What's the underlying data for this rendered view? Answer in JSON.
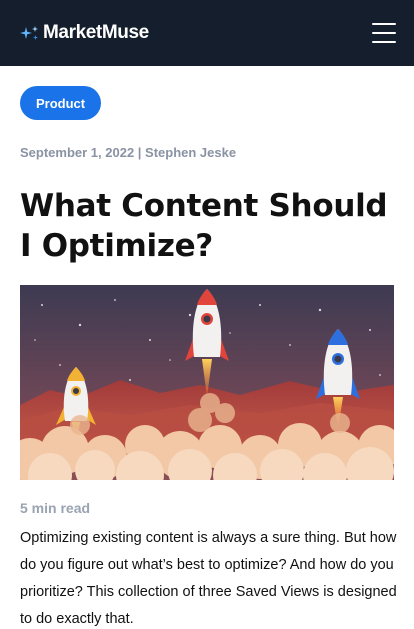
{
  "header": {
    "logo_text": "MarketMuse",
    "menu_icon": "hamburger-menu-icon",
    "background": "#151e2c"
  },
  "article": {
    "category_tag": "Product",
    "byline": "September 1, 2022 | Stephen Jeske",
    "title": "What Content Should I Optimize?",
    "hero_image": "rockets-launching-illustration",
    "read_time": "5 min read",
    "intro": "Optimizing existing content is always a sure thing. But how do you figure out what’s best to optimize? And how do you prioritize? This collection of three Saved Views is designed to do exactly that."
  },
  "colors": {
    "accent": "#1a73e8",
    "muted_text": "#8a93a3"
  }
}
